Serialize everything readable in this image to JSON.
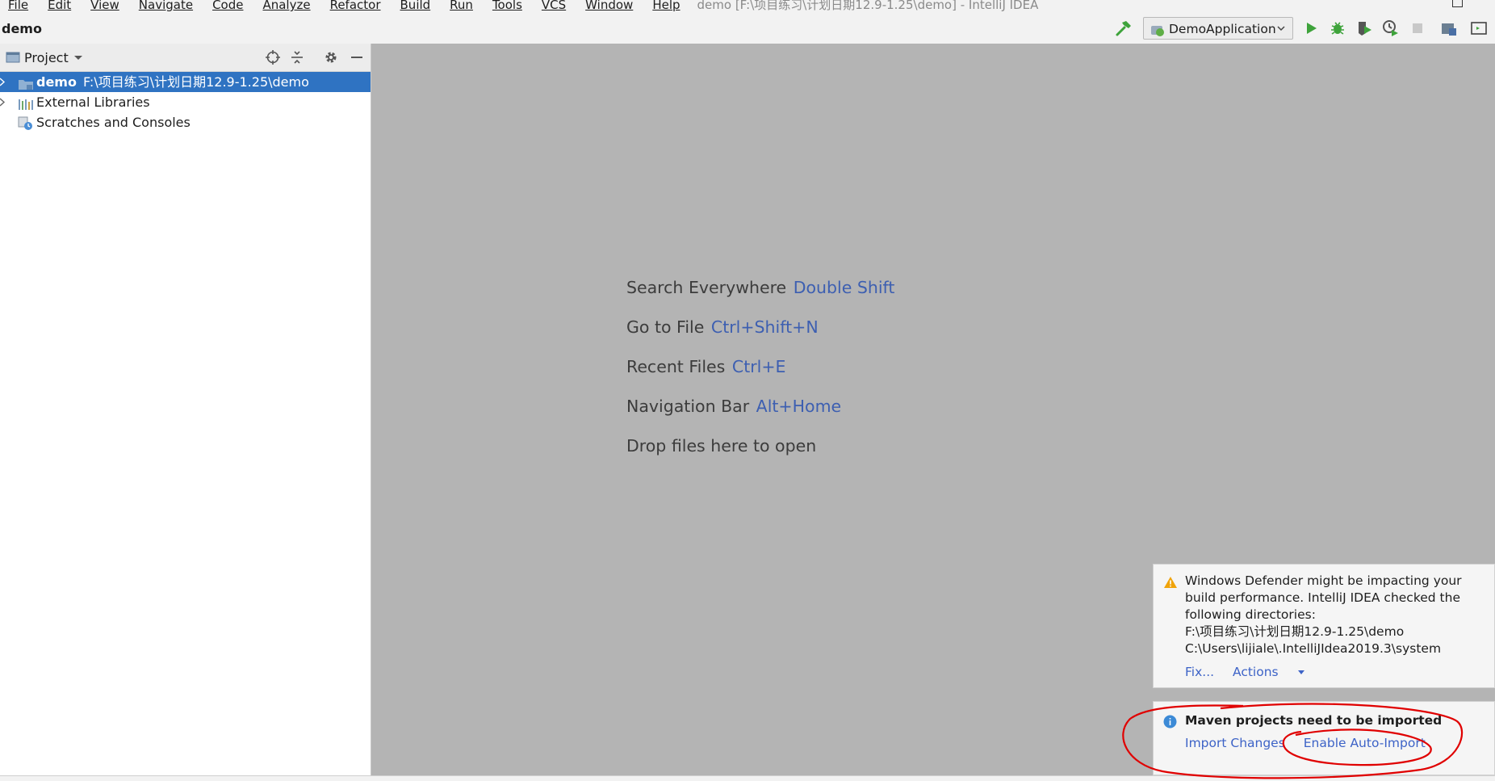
{
  "menu": {
    "items": [
      "File",
      "Edit",
      "View",
      "Navigate",
      "Code",
      "Analyze",
      "Refactor",
      "Build",
      "Run",
      "Tools",
      "VCS",
      "Window",
      "Help"
    ],
    "window_title": "demo [F:\\项目练习\\计划日期12.9-1.25\\demo] - IntelliJ IDEA"
  },
  "navbar": {
    "breadcrumb": "demo",
    "run_config": "DemoApplication"
  },
  "project_panel": {
    "title": "Project",
    "tree": [
      {
        "label": "demo",
        "path": "F:\\项目练习\\计划日期12.9-1.25\\demo"
      },
      {
        "label": "External Libraries"
      },
      {
        "label": "Scratches and Consoles"
      }
    ]
  },
  "editor": {
    "hints": [
      {
        "text": "Search Everywhere",
        "shortcut": "Double Shift"
      },
      {
        "text": "Go to File",
        "shortcut": "Ctrl+Shift+N"
      },
      {
        "text": "Recent Files",
        "shortcut": "Ctrl+E"
      },
      {
        "text": "Navigation Bar",
        "shortcut": "Alt+Home"
      },
      {
        "text": "Drop files here to open",
        "shortcut": ""
      }
    ]
  },
  "notifications": {
    "defender": {
      "lines": [
        "Windows Defender might be impacting your",
        "build performance. IntelliJ IDEA checked the",
        "following directories:",
        "F:\\项目练习\\计划日期12.9-1.25\\demo",
        "C:\\Users\\lijiale\\.IntelliJIdea2019.3\\system"
      ],
      "fix": "Fix...",
      "actions": "Actions"
    },
    "maven": {
      "title": "Maven projects need to be imported",
      "import_changes": "Import Changes",
      "enable_auto_import": "Enable Auto-Import"
    }
  },
  "colors": {
    "selection": "#2f73c2",
    "link": "#3d63c7",
    "shortcut": "#3d5fb1",
    "run_green": "#3ea33b",
    "annotation_red": "#e00000"
  },
  "icons": [
    "build-hammer-icon",
    "run-icon",
    "debug-icon",
    "coverage-icon",
    "profile-icon",
    "stop-icon",
    "project-structure-icon",
    "terminal-icon",
    "locate-icon",
    "collapse-all-icon",
    "gear-icon",
    "minimize-icon",
    "folder-icon",
    "libraries-icon",
    "scratches-icon",
    "warning-icon",
    "info-icon"
  ]
}
